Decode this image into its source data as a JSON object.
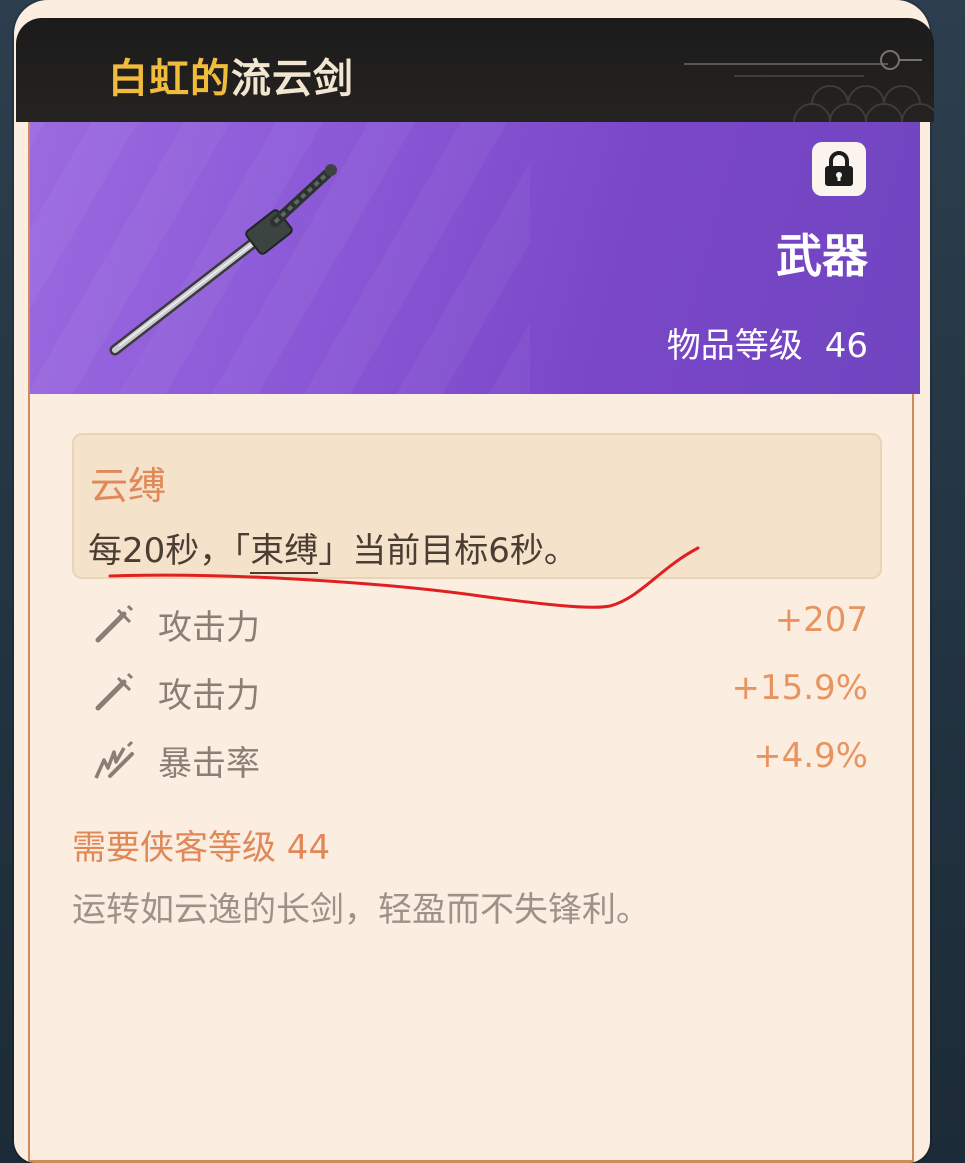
{
  "item": {
    "name_highlight": "白虹的",
    "name_rest": "流云剑",
    "type": "武器",
    "level_label": "物品等级",
    "level_value": "46",
    "lock_icon": "lock-icon"
  },
  "effect": {
    "name": "云缚",
    "desc_before": "每20秒，「",
    "desc_keyword": "束缚",
    "desc_after": "」当前目标6秒。"
  },
  "stats": [
    {
      "icon": "sword-icon",
      "label": "攻击力",
      "value": "+207"
    },
    {
      "icon": "sword-icon",
      "label": "攻击力",
      "value": "+15.9%"
    },
    {
      "icon": "crit-icon",
      "label": "暴击率",
      "value": "+4.9%"
    }
  ],
  "requirement": "需要侠客等级 44",
  "flavor_text": "运转如云逸的长剑，轻盈而不失锋利。",
  "colors": {
    "header_bg": "#1b1b1b",
    "title_highlight": "#f1bc3c",
    "banner_purple": "#8a58d6",
    "accent_orange": "#e08858",
    "card_bg": "#fbeee0",
    "annotation_red": "#e02020"
  }
}
